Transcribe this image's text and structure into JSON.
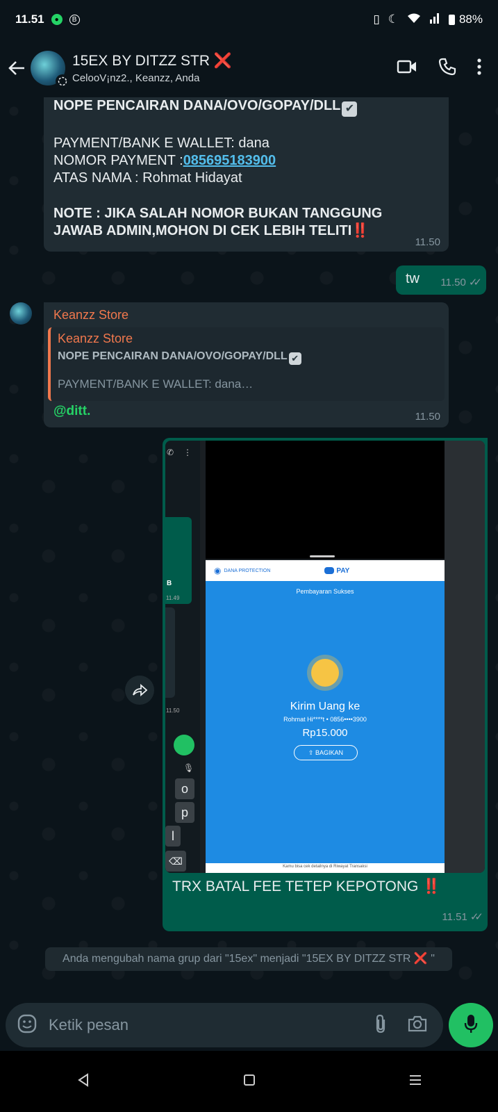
{
  "status": {
    "time": "11.51",
    "battery": "88%",
    "icon_names": [
      "vibrate-icon",
      "moon-icon",
      "wifi-icon",
      "signal-icon",
      "battery-icon"
    ]
  },
  "header": {
    "title": "15EX BY DITZZ STR",
    "title_suffix": "❌",
    "subtitle": "CelooV¡nz2., Keanzz, Anda"
  },
  "messages": {
    "m1": {
      "line1": "NOPE PENCAIRAN DANA/OVO/GOPAY/DLL",
      "line2": "PAYMENT/BANK E WALLET: dana",
      "line3_label": "NOMOR PAYMENT :",
      "line3_number": "085695183900",
      "line4": "ATAS NAMA : Rohmat Hidayat",
      "note1": "NOTE : JIKA SALAH NOMOR BUKAN TANGGUNG",
      "note2": "JAWAB ADMIN,MOHON DI CEK LEBIH TELITI",
      "exclaim": "‼️",
      "time": "11.50"
    },
    "m2": {
      "text": "tw",
      "time": "11.50"
    },
    "m3": {
      "sender": "Keanzz Store",
      "quote_name": "Keanzz Store",
      "quote_line1": "NOPE PENCAIRAN DANA/OVO/GOPAY/DLL",
      "quote_line2": "PAYMENT/BANK E WALLET: dana…",
      "text": "@ditt.",
      "time": "11.50"
    },
    "m4": {
      "receipt_brand": "DANA PROTECTION",
      "receipt_pay": "PAY",
      "receipt_status": "Pembayaran Sukses",
      "receipt_title": "Kirim Uang ke",
      "receipt_recipient": "Rohmat Hi****t • 0856••••3900",
      "receipt_amount": "Rp15.000",
      "receipt_share": "BAGIKAN",
      "receipt_footer": "Kamu bisa cek detailnya di Riwayat Transaksi",
      "side_time1": "11.49",
      "side_time2": "11.50",
      "side_label": "B",
      "keys": [
        "o",
        "p",
        "l"
      ],
      "caption": "TRX BATAL FEE TETEP KEPOTONG",
      "caption_exclaim": "‼️",
      "time": "11.51"
    }
  },
  "system_message": {
    "text": "Anda mengubah nama grup dari \"15ex\" menjadi \"15EX BY DITZZ STR",
    "suffix": "❌",
    "end": " \""
  },
  "input": {
    "placeholder": "Ketik pesan"
  },
  "colors": {
    "accent": "#21c063",
    "outgoing": "#005c4b",
    "incoming": "#202c33",
    "sender": "#f1784d",
    "link": "#53bdeb"
  }
}
